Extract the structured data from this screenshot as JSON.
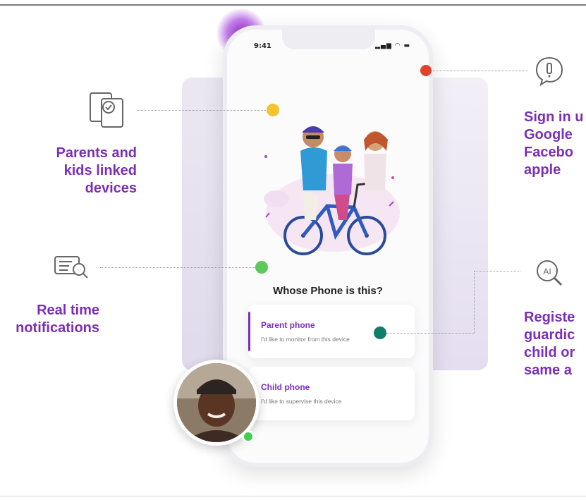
{
  "phone": {
    "status_time": "9:41",
    "question": "Whose Phone is this?",
    "options": [
      {
        "title": "Parent phone",
        "subtitle": "I'd like to monitor from this device"
      },
      {
        "title": "Child phone",
        "subtitle": "I'd like to supervise this device"
      }
    ]
  },
  "features": {
    "linked_devices": [
      "Parents and",
      "kids linked",
      "devices"
    ],
    "notifications": [
      "Real time",
      "notifications"
    ],
    "sign_in": [
      "Sign in u",
      "Google",
      "Facebo",
      "apple"
    ],
    "register": [
      "Registe",
      "guardic",
      "child or",
      "same a"
    ]
  },
  "icons": {
    "linked_devices": "linked-devices-icon",
    "notifications": "notification-list-search-icon",
    "sign_in": "security-alert-bubble-icon",
    "register": "ai-search-icon",
    "ai_label": "AI"
  },
  "colors": {
    "brand_purple": "#7b2fb5",
    "dot_red": "#e0432a",
    "dot_yellow": "#f4c430",
    "dot_green": "#5cc95a",
    "dot_teal": "#0f7f6a",
    "online_green": "#3fcf52"
  }
}
